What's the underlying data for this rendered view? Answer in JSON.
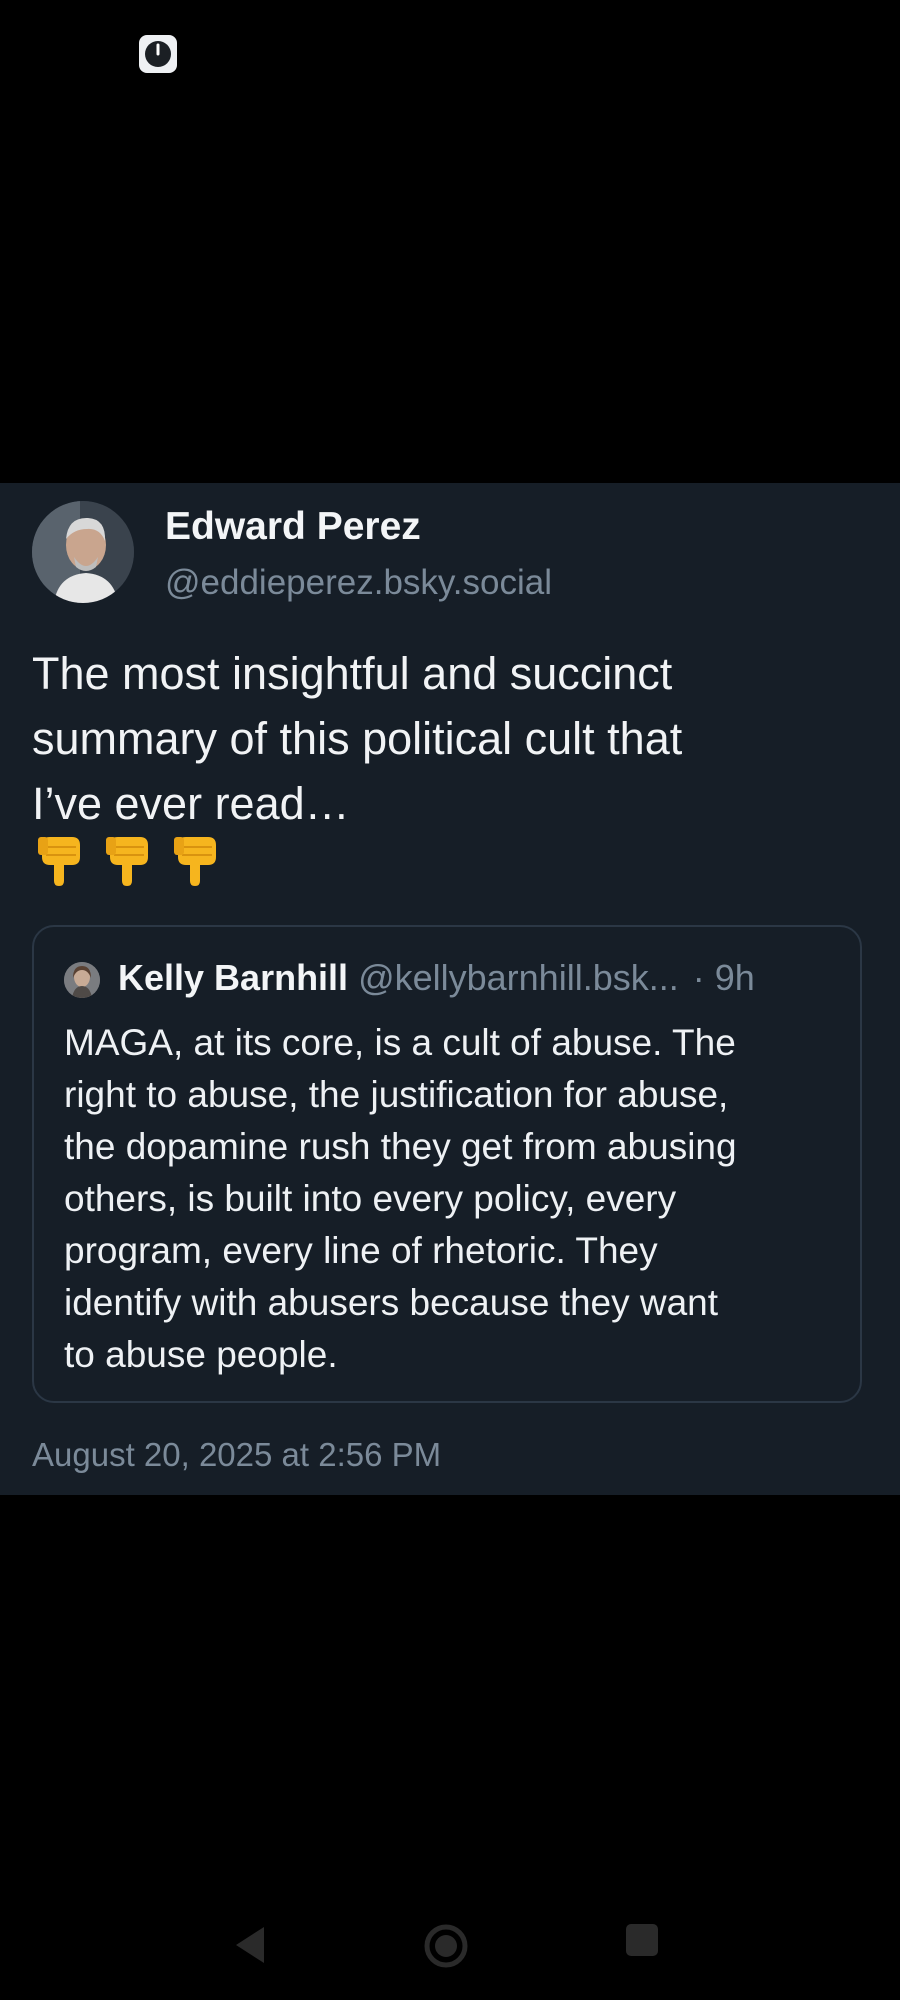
{
  "status_bar": {
    "icon": "clock-icon"
  },
  "post": {
    "author": {
      "name": "Edward Perez",
      "handle": "@eddieperez.bsky.social",
      "avatar": "avatar-photo"
    },
    "text_lines": [
      "The most insightful and succinct",
      "summary of this political cult that",
      "I’ve ever read…"
    ],
    "emoji": [
      "backhand-index-pointing-down",
      "backhand-index-pointing-down",
      "backhand-index-pointing-down"
    ],
    "quote": {
      "author_name": "Kelly Barnhill",
      "handle": "@kellybarnhill.bsk...",
      "time": "· 9h",
      "text_lines": [
        "MAGA, at its core, is a cult of abuse. The",
        "right to abuse, the justification for abuse,",
        "the dopamine rush they get from abusing",
        "others, is built into every policy, every",
        "program, every line of rhetoric. They",
        "identify with abusers because they want",
        "to abuse people."
      ]
    },
    "timestamp": "August 20, 2025 at 2:56 PM"
  },
  "nav_bar": {
    "back": "back-triangle-icon",
    "home": "home-circle-icon",
    "recents": "recents-square-icon"
  },
  "colors": {
    "page_background": "#000000",
    "card_background": "#161e27",
    "muted_text": "#7b8a99",
    "border": "#2b3745"
  }
}
